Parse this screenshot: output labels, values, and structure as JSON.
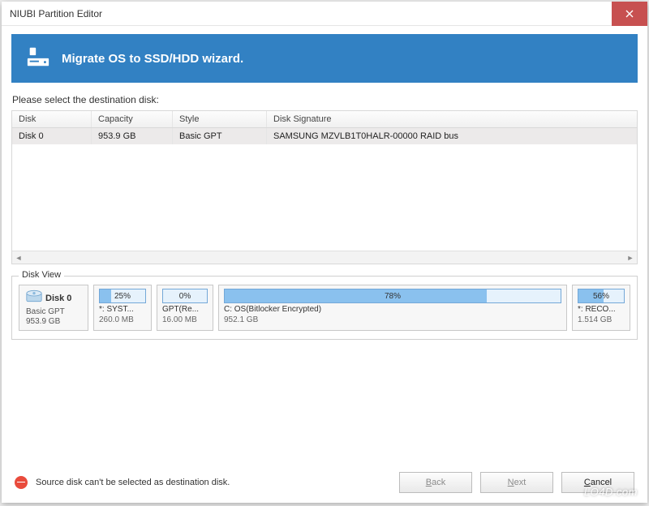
{
  "window": {
    "title": "NIUBI Partition Editor"
  },
  "banner": {
    "title": "Migrate OS to SSD/HDD wizard."
  },
  "prompt": "Please select the destination disk:",
  "table": {
    "headers": {
      "disk": "Disk",
      "capacity": "Capacity",
      "style": "Style",
      "signature": "Disk Signature"
    },
    "rows": [
      {
        "disk": "Disk 0",
        "capacity": "953.9 GB",
        "style": "Basic GPT",
        "signature": "SAMSUNG MZVLB1T0HALR-00000 RAID bus"
      }
    ]
  },
  "diskview": {
    "legend": "Disk View",
    "disk": {
      "name": "Disk 0",
      "style": "Basic GPT",
      "capacity": "953.9 GB"
    },
    "partitions": [
      {
        "pct": "25%",
        "fill": 25,
        "label": "*: SYST...",
        "size": "260.0 MB"
      },
      {
        "pct": "0%",
        "fill": 0,
        "label": "GPT(Re...",
        "size": "16.00 MB"
      },
      {
        "pct": "78%",
        "fill": 78,
        "label": "C: OS(Bitlocker Encrypted)",
        "size": "952.1 GB"
      },
      {
        "pct": "56%",
        "fill": 56,
        "label": "*: RECO...",
        "size": "1.514 GB"
      }
    ]
  },
  "error": "Source disk can't be selected as destination disk.",
  "buttons": {
    "back": "Back",
    "next": "Next",
    "cancel": "Cancel"
  },
  "watermark": "LO4D.com"
}
